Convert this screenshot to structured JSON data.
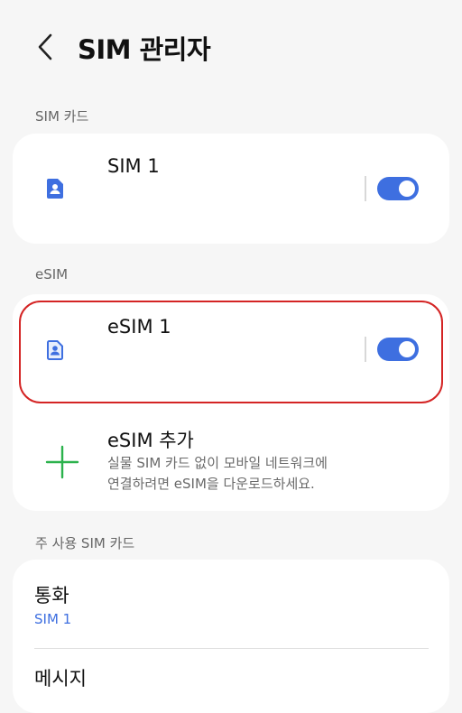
{
  "header": {
    "title": "SIM 관리자",
    "back_icon": "chevron-left-icon"
  },
  "sections": {
    "sim_card": {
      "label": "SIM 카드",
      "items": [
        {
          "title": "SIM 1",
          "icon": "sim-card-icon",
          "toggle_on": true
        }
      ]
    },
    "esim": {
      "label": "eSIM",
      "items": [
        {
          "title": "eSIM 1",
          "icon": "esim-card-icon",
          "toggle_on": true
        }
      ],
      "add": {
        "title": "eSIM 추가",
        "description_line1": "실물 SIM 카드 없이 모바일 네트워크에",
        "description_line2": "연결하려면 eSIM을 다운로드하세요.",
        "icon": "plus-icon"
      }
    },
    "primary_sim": {
      "label": "주 사용 SIM 카드",
      "items": [
        {
          "title": "통화",
          "value": "SIM 1"
        },
        {
          "title": "메시지"
        }
      ]
    }
  },
  "colors": {
    "accent": "#3e6fe0",
    "highlight": "#d42424",
    "plus": "#2bb24c",
    "background": "#f6f6f6"
  }
}
